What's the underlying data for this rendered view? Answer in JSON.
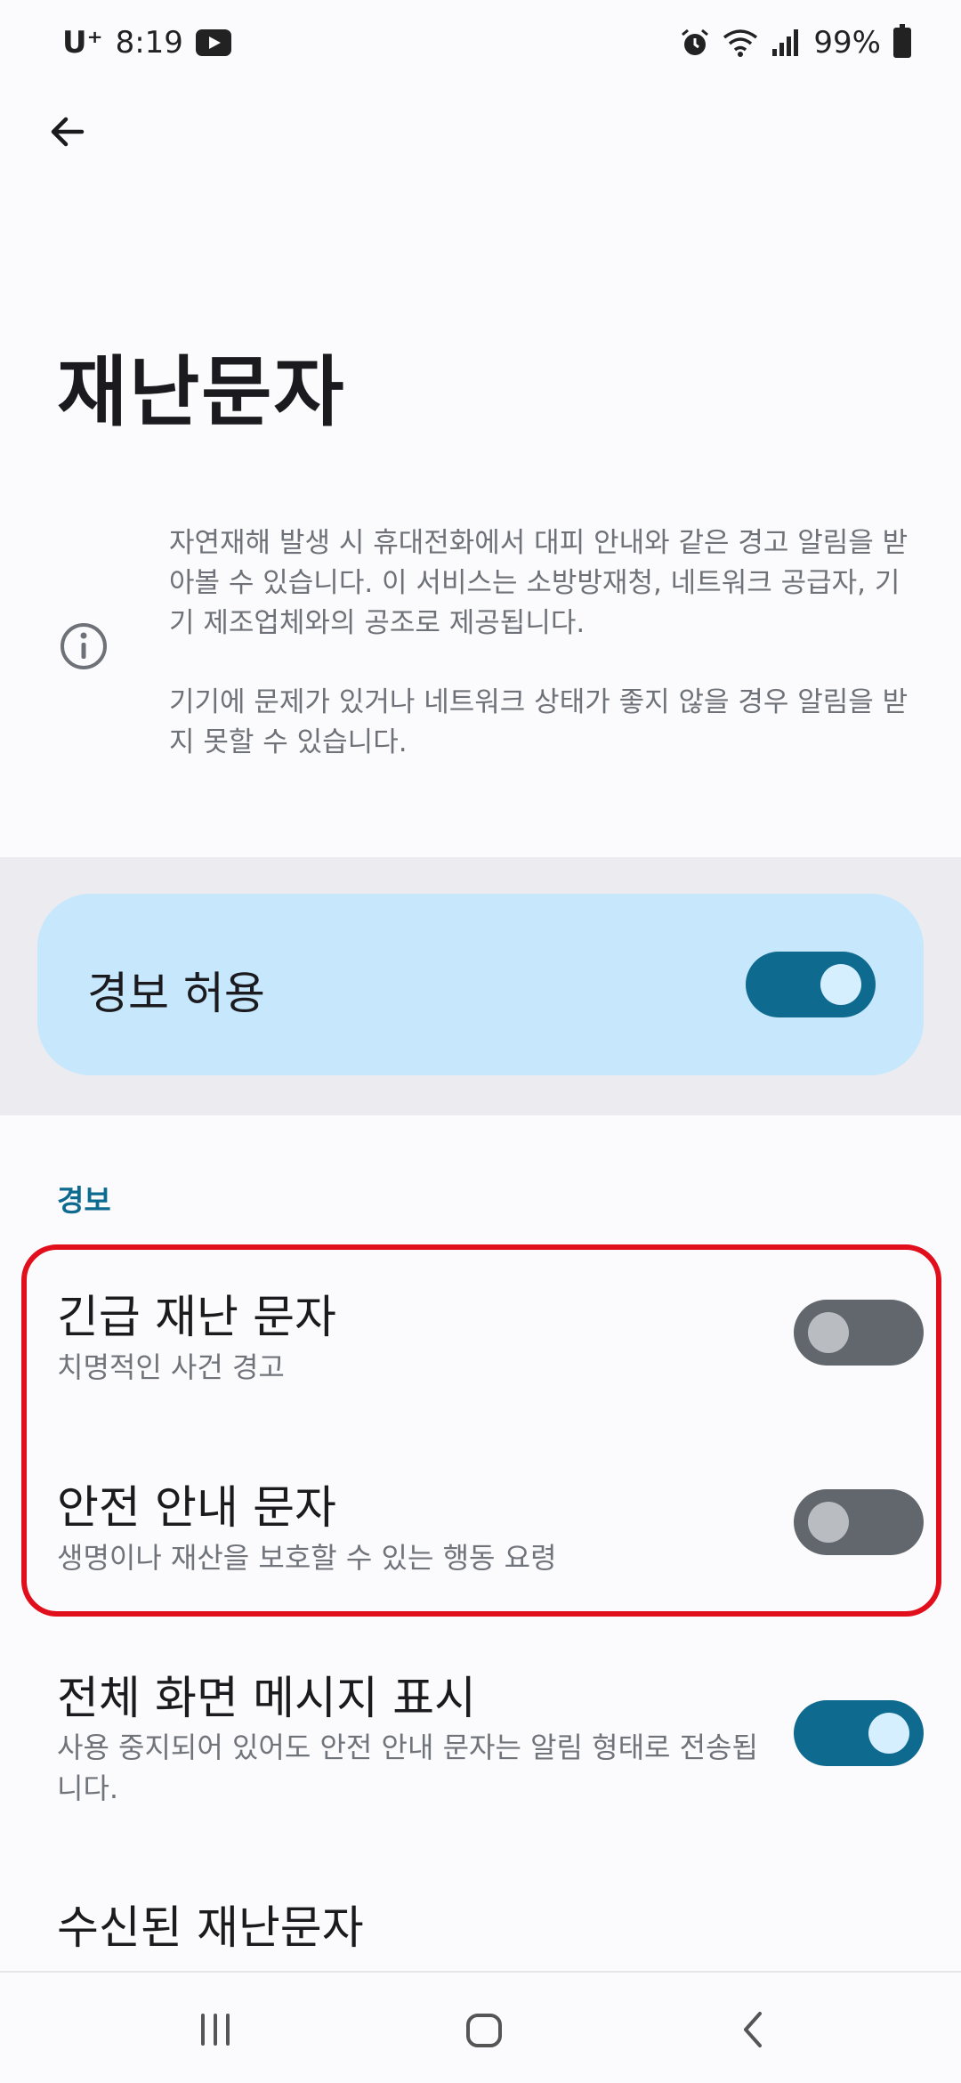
{
  "status_bar": {
    "carrier": "U⁺",
    "time": "8:19",
    "battery": "99%",
    "icons": [
      "youtube-icon",
      "alarm-icon",
      "wifi-icon",
      "signal-icon",
      "battery-icon"
    ]
  },
  "header": {
    "back_icon": "arrow-left-icon",
    "title": "재난문자"
  },
  "info": {
    "icon": "info-icon",
    "paragraph1": "자연재해 발생 시 휴대전화에서 대피 안내와 같은 경고 알림을 받아볼 수 있습니다. 이 서비스는 소방방재청, 네트워크 공급자, 기기 제조업체와의 공조로 제공됩니다.",
    "paragraph2": "기기에 문제가 있거나 네트워크 상태가 좋지 않을 경우 알림을 받지 못할 수 있습니다."
  },
  "master_toggle": {
    "label": "경보 허용",
    "state": "on"
  },
  "alerts_section": {
    "header": "경보",
    "items": [
      {
        "title": "긴급 재난 문자",
        "subtitle": "치명적인 사건 경고",
        "state": "off"
      },
      {
        "title": "안전 안내 문자",
        "subtitle": "생명이나 재산을 보호할 수 있는 행동 요령",
        "state": "off"
      }
    ]
  },
  "fullscreen_setting": {
    "title": "전체 화면 메시지 표시",
    "subtitle": "사용 중지되어 있어도 안전 안내 문자는 알림 형태로 전송됩니다.",
    "state": "on"
  },
  "received_messages": {
    "title": "수신된 재난문자"
  },
  "nav_bar": {
    "recents_icon": "recents-icon",
    "home_icon": "home-icon",
    "back_icon": "back-chevron-icon"
  },
  "colors": {
    "accent": "#0f6a8f",
    "card_bg": "#c6e7fc",
    "highlight": "#e10e1b",
    "toggle_off": "#62676d"
  }
}
